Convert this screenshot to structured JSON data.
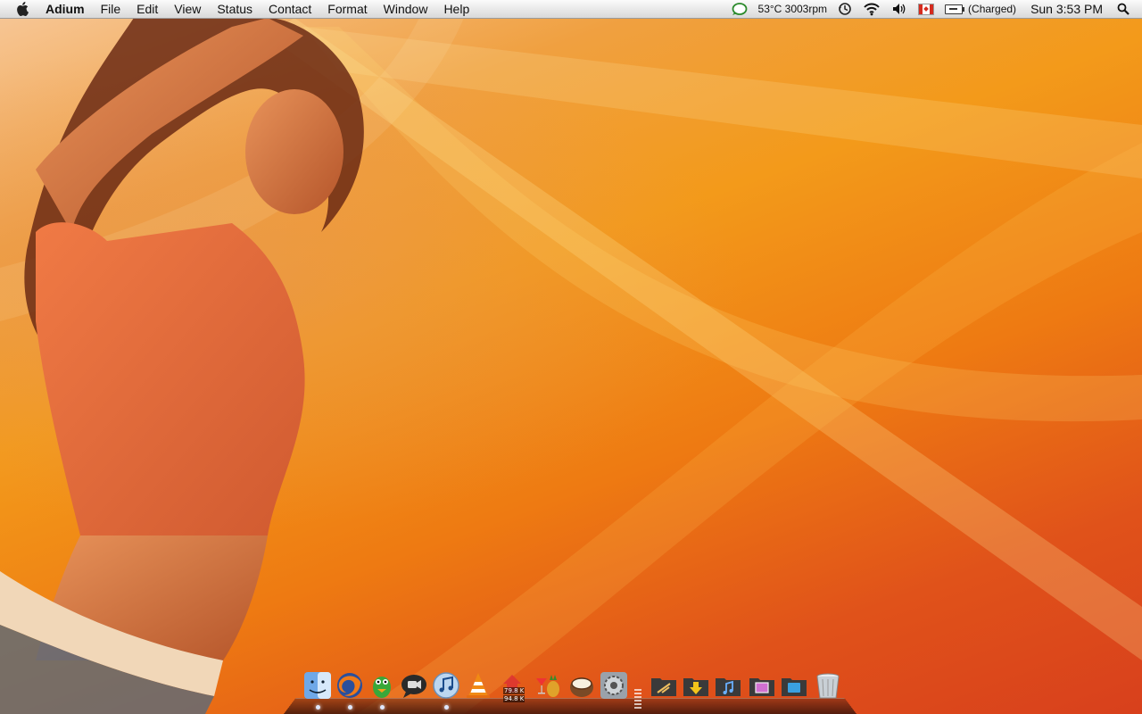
{
  "menubar": {
    "app_name": "Adium",
    "menus": [
      "File",
      "Edit",
      "View",
      "Status",
      "Contact",
      "Format",
      "Window",
      "Help"
    ],
    "extras": {
      "temperature_fan": "53°C 3003rpm",
      "battery_status": "(Charged)",
      "clock": "Sun 3:53 PM"
    },
    "icons": [
      "apple-icon",
      "adium-status-icon",
      "time-machine-icon",
      "wifi-icon",
      "volume-icon",
      "canada-flag-icon",
      "battery-icon",
      "spotlight-icon"
    ]
  },
  "dock": {
    "apps": [
      "finder-icon",
      "firefox-icon",
      "adium-icon",
      "ichat-icon",
      "itunes-icon",
      "vlc-icon",
      "network-monitor-icon",
      "cocktail-icon",
      "coconut-battery-icon",
      "system-preferences-icon"
    ],
    "folders": [
      "applications-folder-icon",
      "downloads-folder-icon",
      "music-folder-icon",
      "pictures-folder-icon",
      "documents-folder-icon",
      "trash-icon"
    ],
    "network_up": "79.8 K",
    "network_down": "94.8 K"
  },
  "colors": {
    "menubar": "#e6e6e6",
    "wallpaper_primary": "#f39a1a",
    "wallpaper_deep": "#d8401c"
  }
}
